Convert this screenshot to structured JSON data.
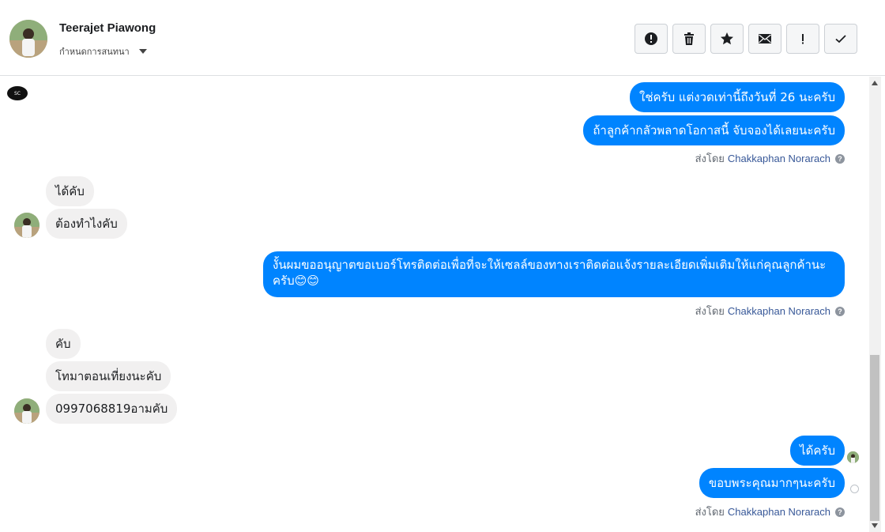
{
  "header": {
    "contact_name": "Teerajet Piawong",
    "assign_label": "กำหนดการสนทนา",
    "toolbar": [
      {
        "name": "spam-button",
        "icon": "alert-circle-icon"
      },
      {
        "name": "delete-button",
        "icon": "trash-icon"
      },
      {
        "name": "star-button",
        "icon": "star-icon"
      },
      {
        "name": "mark-unread-button",
        "icon": "envelope-icon"
      },
      {
        "name": "follow-up-button",
        "icon": "exclamation-icon"
      },
      {
        "name": "mark-done-button",
        "icon": "checkmark-icon"
      }
    ]
  },
  "page_avatar_text": "SC",
  "messages": [
    {
      "direction": "out",
      "text": "ใช่ครับ แต่งวดเท่านี้ถึงวันที่ 26 นะครับ"
    },
    {
      "direction": "out",
      "text": "ถ้าลูกค้ากลัวพลาดโอกาสนี้ จับจองได้เลยนะครับ"
    },
    {
      "direction": "in",
      "text": "ได้คับ"
    },
    {
      "direction": "in",
      "text": "ต้องทำไงคับ"
    },
    {
      "direction": "out",
      "text": "งั้นผมขออนุญาตขอเบอร์โทรติดต่อเพื่อที่จะให้เซลล์ของทางเราติดต่อแจ้งรายละเอียดเพิ่มเติมให้แก่คุณลูกค้านะ",
      "text2": "ครับ😊😊"
    },
    {
      "direction": "in",
      "text": "คับ"
    },
    {
      "direction": "in",
      "text": "โทมาตอนเที่ยงนะคับ"
    },
    {
      "direction": "in",
      "text": "0997068819อามคับ"
    },
    {
      "direction": "out",
      "text": "ได้ครับ"
    },
    {
      "direction": "out",
      "text": "ขอบพระคุณมากๆนะครับ"
    }
  ],
  "sent_by": {
    "prefix": "ส่งโดย",
    "agent": "Chakkaphan Norarach"
  },
  "colors": {
    "outgoing_bubble": "#0084ff",
    "incoming_bubble": "#f1f0f0",
    "agent_link": "#385898"
  }
}
